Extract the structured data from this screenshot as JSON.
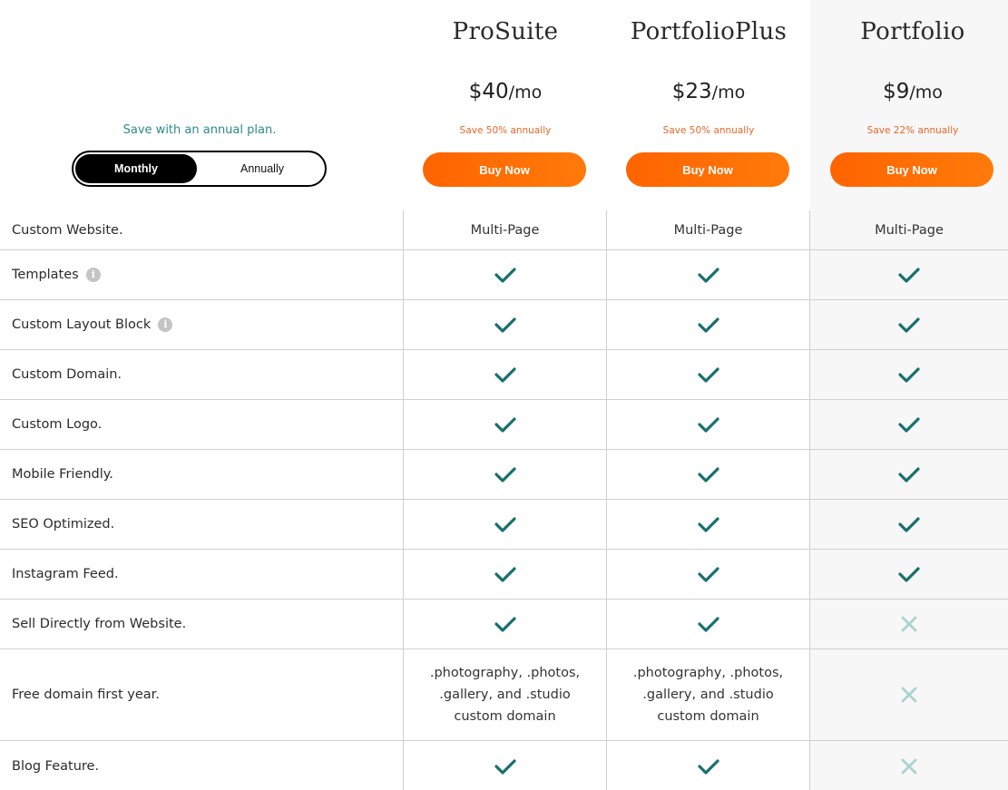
{
  "billing": {
    "note": "Save with an annual plan.",
    "toggle": {
      "options": [
        "Monthly",
        "Annually"
      ],
      "selected": "Monthly"
    }
  },
  "plans": [
    {
      "name": "ProSuite",
      "price": "$40",
      "period": "/mo",
      "save": "Save 50% annually",
      "cta": "Buy Now"
    },
    {
      "name": "PortfolioPlus",
      "price": "$23",
      "period": "/mo",
      "save": "Save 50% annually",
      "cta": "Buy Now"
    },
    {
      "name": "Portfolio",
      "price": "$9",
      "period": "/mo",
      "save": "Save 22% annually",
      "cta": "Buy Now"
    }
  ],
  "colors": {
    "accent_orange": "#ff6a00",
    "check_teal": "#17706e",
    "x_light_teal": "#a9d3d1",
    "note_teal": "#2e8a8a",
    "save_orange": "#e8672a"
  },
  "features": [
    {
      "label": "Custom Website.",
      "info": false,
      "values": [
        {
          "type": "text",
          "text": "Multi-Page"
        },
        {
          "type": "text",
          "text": "Multi-Page"
        },
        {
          "type": "text",
          "text": "Multi-Page"
        }
      ]
    },
    {
      "label": "Templates",
      "info": true,
      "values": [
        {
          "type": "check"
        },
        {
          "type": "check"
        },
        {
          "type": "check"
        }
      ]
    },
    {
      "label": "Custom Layout Block",
      "info": true,
      "values": [
        {
          "type": "check"
        },
        {
          "type": "check"
        },
        {
          "type": "check"
        }
      ]
    },
    {
      "label": "Custom Domain.",
      "info": false,
      "values": [
        {
          "type": "check"
        },
        {
          "type": "check"
        },
        {
          "type": "check"
        }
      ]
    },
    {
      "label": "Custom Logo.",
      "info": false,
      "values": [
        {
          "type": "check"
        },
        {
          "type": "check"
        },
        {
          "type": "check"
        }
      ]
    },
    {
      "label": "Mobile Friendly.",
      "info": false,
      "values": [
        {
          "type": "check"
        },
        {
          "type": "check"
        },
        {
          "type": "check"
        }
      ]
    },
    {
      "label": "SEO Optimized.",
      "info": false,
      "values": [
        {
          "type": "check"
        },
        {
          "type": "check"
        },
        {
          "type": "check"
        }
      ]
    },
    {
      "label": "Instagram Feed.",
      "info": false,
      "values": [
        {
          "type": "check"
        },
        {
          "type": "check"
        },
        {
          "type": "check"
        }
      ]
    },
    {
      "label": "Sell Directly from Website.",
      "info": false,
      "values": [
        {
          "type": "check"
        },
        {
          "type": "check"
        },
        {
          "type": "x"
        }
      ]
    },
    {
      "label": "Free domain first year.",
      "info": false,
      "values": [
        {
          "type": "text",
          "text": ".photography, .photos, .gallery, and .studio custom domain"
        },
        {
          "type": "text",
          "text": ".photography, .photos, .gallery, and .studio custom domain"
        },
        {
          "type": "x"
        }
      ]
    },
    {
      "label": "Blog Feature.",
      "info": false,
      "values": [
        {
          "type": "check"
        },
        {
          "type": "check"
        },
        {
          "type": "x"
        }
      ]
    }
  ]
}
